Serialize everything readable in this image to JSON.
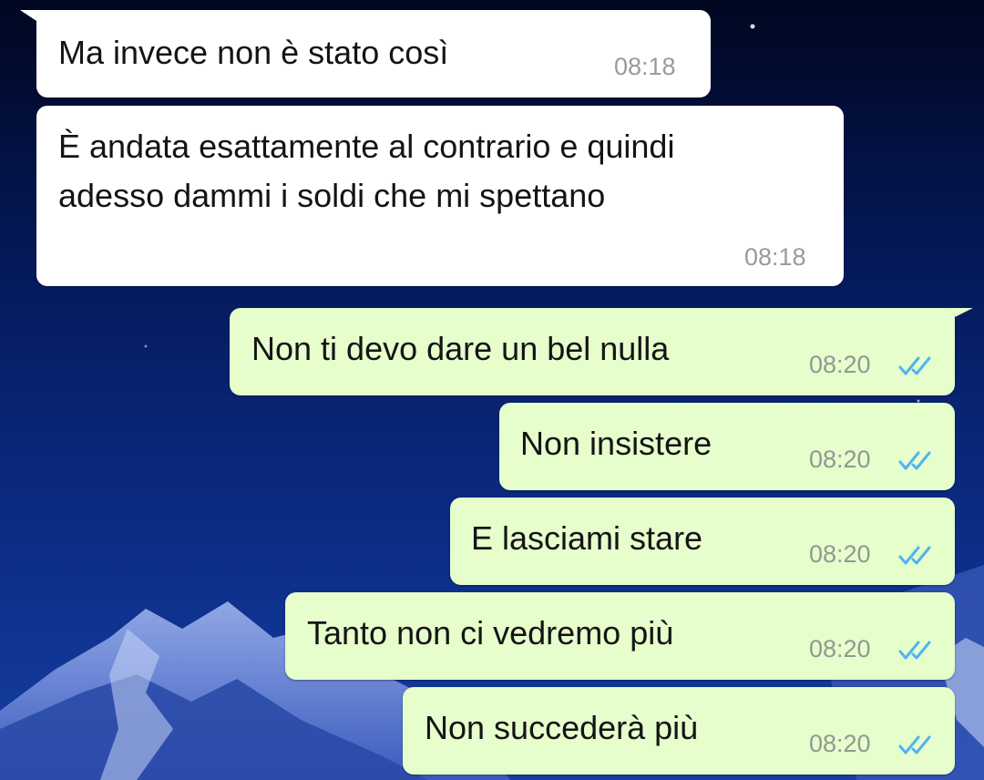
{
  "chat": {
    "incoming": [
      {
        "text": "Ma invece non è stato così",
        "time": "08:18"
      },
      {
        "line1": "È andata esattamente al contrario e quindi",
        "line2": "adesso dammi i soldi che mi spettano",
        "time": "08:18"
      }
    ],
    "outgoing": [
      {
        "text": "Non ti devo dare un bel nulla",
        "time": "08:20",
        "status": "read"
      },
      {
        "text": "Non insistere",
        "time": "08:20",
        "status": "read"
      },
      {
        "text": "E lasciami stare",
        "time": "08:20",
        "status": "read"
      },
      {
        "text": "Tanto non ci vedremo più",
        "time": "08:20",
        "status": "read"
      },
      {
        "text": "Non succederà più",
        "time": "08:20",
        "status": "read"
      }
    ]
  },
  "colors": {
    "incoming_bubble": "#ffffff",
    "outgoing_bubble": "#e6fdcc",
    "read_ticks": "#4fb4f0"
  },
  "icons": {
    "read_receipt": "double-check-icon"
  }
}
